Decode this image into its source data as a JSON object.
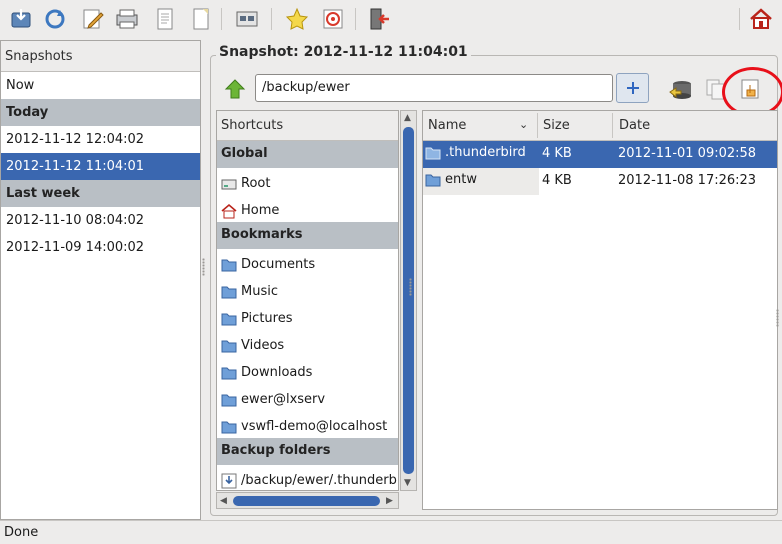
{
  "toolbar": {
    "buttons": [
      {
        "name": "take-snapshot-icon"
      },
      {
        "name": "refresh-icon"
      },
      {
        "name": "edit-name-icon"
      },
      {
        "name": "remove-snapshot-icon"
      },
      {
        "name": "view-log-icon"
      },
      {
        "name": "view-last-log-icon"
      },
      {
        "name": "settings-icon"
      },
      {
        "name": "shutdown-icon"
      },
      {
        "name": "help-icon"
      },
      {
        "name": "exit-icon"
      },
      {
        "name": "home-icon"
      }
    ]
  },
  "snapshots": {
    "header": "Snapshots",
    "items": [
      {
        "type": "item",
        "label": "Now"
      },
      {
        "type": "group",
        "label": "Today"
      },
      {
        "type": "item",
        "label": "2012-11-12 12:04:02"
      },
      {
        "type": "item",
        "label": "2012-11-12 11:04:01",
        "selected": true
      },
      {
        "type": "group",
        "label": "Last week"
      },
      {
        "type": "item",
        "label": "2012-11-10 08:04:02"
      },
      {
        "type": "item",
        "label": "2012-11-09 14:00:02"
      }
    ]
  },
  "snapshot_title": "Snapshot: 2012-11-12 11:04:01",
  "path": {
    "value": "/backup/ewer"
  },
  "shortcuts": {
    "header": "Shortcuts",
    "items": [
      {
        "type": "group",
        "label": "Global"
      },
      {
        "type": "item",
        "label": "Root",
        "icon": "drive-icon"
      },
      {
        "type": "item",
        "label": "Home",
        "icon": "home-folder-icon"
      },
      {
        "type": "group",
        "label": "Bookmarks"
      },
      {
        "type": "item",
        "label": "Documents",
        "icon": "folder-icon"
      },
      {
        "type": "item",
        "label": "Music",
        "icon": "folder-icon"
      },
      {
        "type": "item",
        "label": "Pictures",
        "icon": "folder-icon"
      },
      {
        "type": "item",
        "label": "Videos",
        "icon": "folder-icon"
      },
      {
        "type": "item",
        "label": "Downloads",
        "icon": "folder-icon"
      },
      {
        "type": "item",
        "label": "ewer@lxserv",
        "icon": "folder-icon"
      },
      {
        "type": "item",
        "label": "vswfl-demo@localhost",
        "icon": "folder-icon"
      },
      {
        "type": "group",
        "label": "Backup folders"
      },
      {
        "type": "item",
        "label": "/backup/ewer/.thunderb",
        "icon": "backup-folder-icon"
      }
    ]
  },
  "files": {
    "columns": {
      "name": "Name",
      "size": "Size",
      "date": "Date"
    },
    "rows": [
      {
        "name": ".thunderbird",
        "size": "4 KB",
        "date": "2012-11-01 09:02:58",
        "selected": true
      },
      {
        "name": "entw",
        "size": "4 KB",
        "date": "2012-11-08 17:26:23",
        "selected": false
      }
    ]
  },
  "status": "Done",
  "colors": {
    "selection": "#3a67b0",
    "group_bg": "#b9bfc5",
    "highlight_circle": "#e8101a"
  }
}
